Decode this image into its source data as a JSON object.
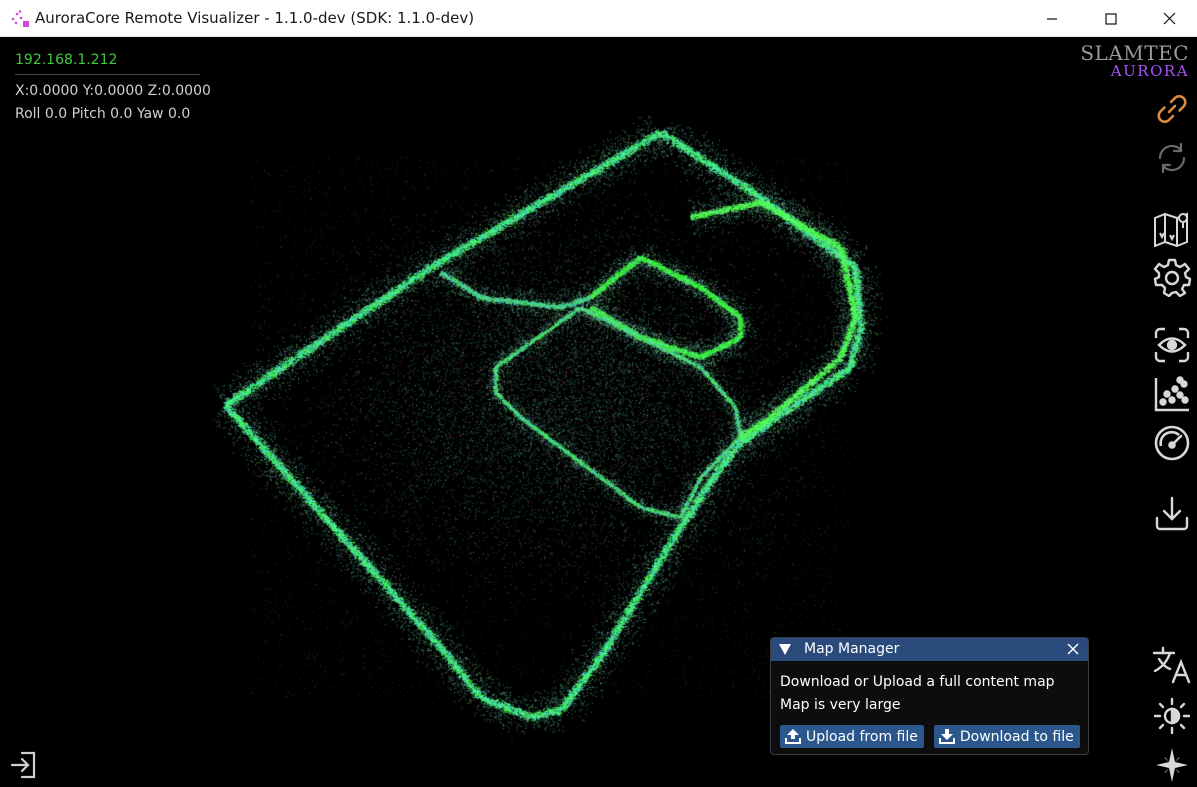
{
  "window": {
    "title": "AuroraCore Remote Visualizer - 1.1.0-dev (SDK: 1.1.0-dev)",
    "controls": [
      "minimize",
      "maximize",
      "close"
    ]
  },
  "status": {
    "ip": "192.168.1.212",
    "position": "X:0.0000 Y:0.0000 Z:0.0000",
    "orientation": "Roll 0.0 Pitch 0.0 Yaw 0.0"
  },
  "logo": {
    "top": "SLAMTEC",
    "bottom": "AURORA"
  },
  "toolbar": {
    "tools": [
      {
        "name": "link-icon",
        "color": "#d98c3f"
      },
      {
        "name": "refresh-icon",
        "color": "#6a6a6a"
      },
      {
        "name": "map-icon",
        "color": "#d8d8d8"
      },
      {
        "name": "gear-icon",
        "color": "#d8d8d8"
      },
      {
        "name": "eye-camera-icon",
        "color": "#d8d8d8"
      },
      {
        "name": "scatter-chart-icon",
        "color": "#d8d8d8"
      },
      {
        "name": "speedometer-icon",
        "color": "#d8d8d8"
      },
      {
        "name": "download-icon",
        "color": "#d8d8d8"
      },
      {
        "name": "translate-icon",
        "color": "#d8d8d8"
      },
      {
        "name": "brightness-icon",
        "color": "#d8d8d8"
      },
      {
        "name": "compass-star-icon",
        "color": "#d8d8d8"
      }
    ]
  },
  "map_manager": {
    "title": "Map Manager",
    "description": "Download or Upload a full content map",
    "warning": "Map is very large",
    "upload_label": "Upload from file",
    "download_label": "Download to file"
  },
  "colors": {
    "accent_green": "#3ec93e",
    "panel_header": "#294a7a",
    "button": "#2b578d",
    "logo_purple": "#a855f7"
  }
}
